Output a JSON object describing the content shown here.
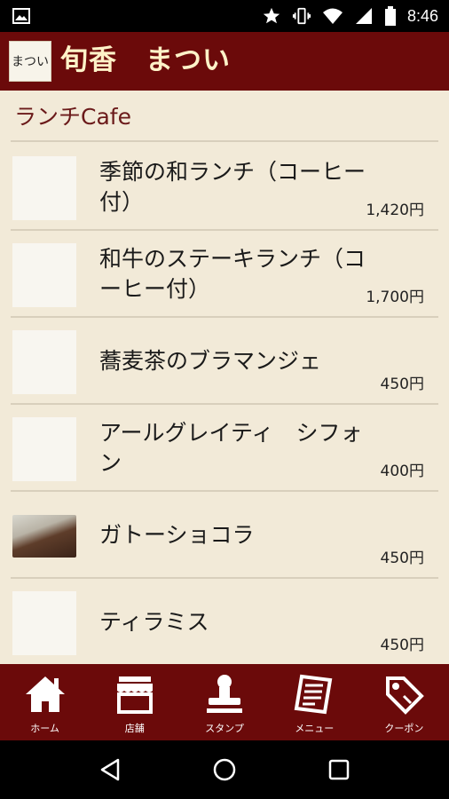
{
  "status_bar": {
    "time": "8:46",
    "icons": [
      "image-icon",
      "star-icon",
      "vibrate-icon",
      "wifi-icon",
      "signal-icon",
      "battery-icon"
    ]
  },
  "header": {
    "logo_text": "まつい",
    "title": "旬香　まつい",
    "background_color": "#6b0a0a"
  },
  "section": {
    "title": "ランチCafe"
  },
  "menu_items": [
    {
      "name": "季節の和ランチ（コーヒー付）",
      "price": "1,420円",
      "has_photo": false
    },
    {
      "name": "和牛のステーキランチ（コーヒー付）",
      "price": "1,700円",
      "has_photo": false
    },
    {
      "name": "蕎麦茶のブラマンジェ",
      "price": "450円",
      "has_photo": false
    },
    {
      "name": "アールグレイティ　シフォン",
      "price": "400円",
      "has_photo": false
    },
    {
      "name": "ガトーショコラ",
      "price": "450円",
      "has_photo": true
    },
    {
      "name": "ティラミス",
      "price": "450円",
      "has_photo": false
    }
  ],
  "tabs": [
    {
      "label": "ホーム",
      "icon": "home-icon"
    },
    {
      "label": "店舗",
      "icon": "store-icon"
    },
    {
      "label": "スタンプ",
      "icon": "stamp-icon"
    },
    {
      "label": "メニュー",
      "icon": "menu-icon"
    },
    {
      "label": "クーポン",
      "icon": "coupon-icon"
    }
  ],
  "nav": {
    "icons": [
      "back-icon",
      "home-circle-icon",
      "recents-icon"
    ]
  }
}
